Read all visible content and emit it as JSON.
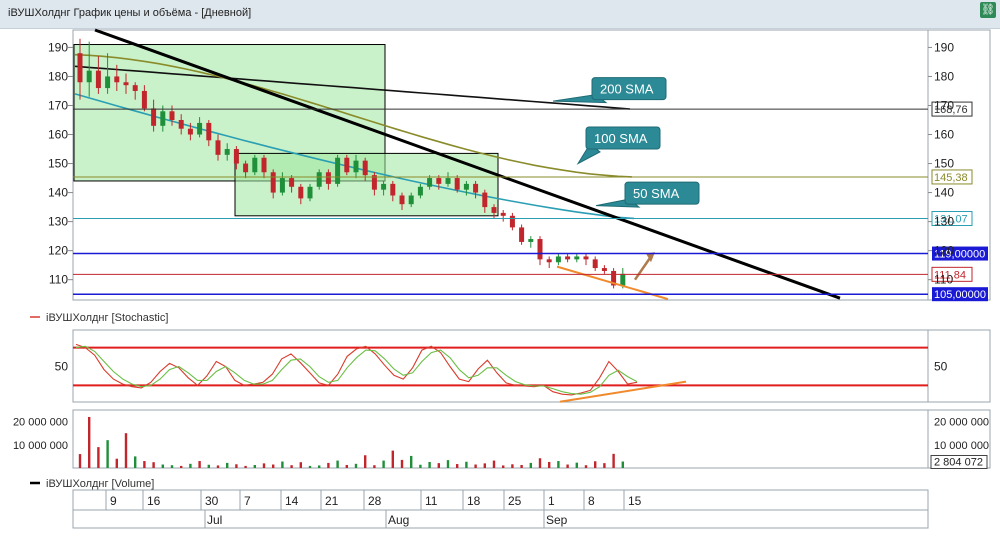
{
  "window": {
    "title": "iВУШХолднг График цены и объёма - [Дневной]",
    "link_icon": "link-icon"
  },
  "colors": {
    "up": "#1f8f3a",
    "down": "#c0262c",
    "sma200": "#111111",
    "sma100": "#8a8b2a",
    "sma50": "#2a9fb3",
    "trend": "#000000",
    "support": "#1a1ad6",
    "highlight": "#9ee89e",
    "stoch_k": "#d93b2c",
    "stoch_d": "#6abf45",
    "orange": "#f08a2c",
    "label_box": "#2b8a96"
  },
  "chart_data": [
    {
      "type": "line",
      "panel": "price",
      "ylim": [
        103,
        196
      ],
      "y_ticks": [
        "190",
        "180",
        "170",
        "160",
        "150",
        "140",
        "130",
        "120",
        "110"
      ],
      "y_right_ticks": [
        "190",
        "180",
        "170",
        "160",
        "150",
        "140",
        "130",
        "120",
        "110"
      ],
      "x_tick_labels": [
        "9",
        "16",
        "30",
        "7",
        "14",
        "21",
        "28",
        "11",
        "18",
        "25",
        "1",
        "8",
        "15"
      ],
      "month_labels": [
        "Jul",
        "Aug",
        "Sep"
      ],
      "candles": [
        [
          188,
          178,
          193,
          172
        ],
        [
          178,
          182,
          192,
          173
        ],
        [
          182,
          176,
          187,
          174
        ],
        [
          176,
          180,
          188,
          174
        ],
        [
          180,
          178,
          184,
          175
        ],
        [
          178,
          177,
          181,
          174
        ],
        [
          177,
          175,
          178,
          172
        ],
        [
          175,
          169,
          177,
          168
        ],
        [
          169,
          163,
          172,
          161
        ],
        [
          163,
          168,
          170,
          161
        ],
        [
          168,
          165,
          170,
          163
        ],
        [
          165,
          162,
          167,
          160
        ],
        [
          162,
          160,
          164,
          158
        ],
        [
          160,
          164,
          166,
          159
        ],
        [
          164,
          158,
          165,
          156
        ],
        [
          158,
          153,
          160,
          151
        ],
        [
          153,
          155,
          157,
          151
        ],
        [
          155,
          150,
          156,
          148
        ],
        [
          150,
          147,
          151,
          145
        ],
        [
          147,
          152,
          153,
          146
        ],
        [
          152,
          147,
          153,
          145
        ],
        [
          147,
          140,
          148,
          138
        ],
        [
          140,
          145,
          147,
          139
        ],
        [
          145,
          142,
          146,
          140
        ],
        [
          142,
          138,
          143,
          136
        ],
        [
          138,
          142,
          143,
          137
        ],
        [
          142,
          147,
          148,
          141
        ],
        [
          147,
          143,
          148,
          141
        ],
        [
          143,
          152,
          153,
          142
        ],
        [
          152,
          147,
          153,
          146
        ],
        [
          147,
          151,
          153,
          145
        ],
        [
          151,
          146,
          152,
          144
        ],
        [
          146,
          141,
          147,
          139
        ],
        [
          141,
          143,
          144,
          139
        ],
        [
          143,
          139,
          144,
          137
        ],
        [
          139,
          136,
          140,
          134
        ],
        [
          136,
          139,
          140,
          135
        ],
        [
          139,
          142,
          143,
          138
        ],
        [
          142,
          145,
          146,
          141
        ],
        [
          145,
          143,
          146,
          141
        ],
        [
          143,
          145,
          147,
          142
        ],
        [
          145,
          141,
          146,
          140
        ],
        [
          141,
          143,
          144,
          139
        ],
        [
          143,
          140,
          144,
          138
        ],
        [
          140,
          135,
          141,
          133
        ],
        [
          135,
          133,
          136,
          131
        ],
        [
          133,
          132,
          134,
          130
        ],
        [
          132,
          128,
          133,
          127
        ],
        [
          128,
          123,
          129,
          122
        ],
        [
          123,
          124,
          125,
          121
        ],
        [
          124,
          117,
          125,
          115
        ],
        [
          117,
          116,
          118,
          114
        ],
        [
          116,
          118,
          119,
          115
        ],
        [
          118,
          117,
          119,
          116
        ],
        [
          117,
          118,
          119,
          116
        ],
        [
          118,
          117,
          119,
          115
        ],
        [
          117,
          114,
          118,
          113
        ],
        [
          114,
          113,
          115,
          112
        ],
        [
          113,
          108,
          114,
          107
        ],
        [
          108,
          112,
          114,
          107
        ]
      ],
      "series": [
        {
          "name": "200 SMA",
          "y_start": 183.5,
          "y_end": 168.8
        },
        {
          "name": "100 SMA",
          "y_start": 187.5,
          "y_end": 145.4
        },
        {
          "name": "50 SMA",
          "y_start": 174.0,
          "y_end": 131.1
        }
      ],
      "trendline": {
        "y_start": 196.0,
        "y_end": 105.0
      },
      "levels": [
        {
          "value": "168,76",
          "y": 168.76,
          "color": "#333333"
        },
        {
          "value": "145,38",
          "y": 145.38,
          "color": "#8a8b2a"
        },
        {
          "value": "131,07",
          "y": 131.07,
          "color": "#2a9fb3"
        },
        {
          "value": "119,00000",
          "y": 119.0,
          "color": "#1a1ad6",
          "filled": true
        },
        {
          "value": "111,84",
          "y": 111.84,
          "color": "#c0262c"
        },
        {
          "value": "105,00000",
          "y": 105.0,
          "color": "#1a1ad6",
          "filled": true
        }
      ],
      "annotations": [
        "200 SMA",
        "100 SMA",
        "50 SMA"
      ]
    },
    {
      "type": "line",
      "panel": "stochastic",
      "title": "iВУШХолднг [Stochastic]",
      "ylim": [
        0,
        100
      ],
      "y_ticks": [
        "50"
      ],
      "y_right_ticks": [
        "50"
      ],
      "levels": [
        80,
        20
      ],
      "series": [
        {
          "name": "%K",
          "values": [
            85,
            80,
            68,
            45,
            30,
            22,
            18,
            16,
            25,
            42,
            55,
            48,
            32,
            20,
            35,
            58,
            50,
            28,
            20,
            22,
            25,
            38,
            62,
            70,
            56,
            40,
            24,
            20,
            38,
            66,
            78,
            82,
            70,
            52,
            36,
            30,
            48,
            76,
            82,
            72,
            50,
            30,
            26,
            46,
            60,
            40,
            24,
            20,
            19,
            18,
            20,
            10,
            6,
            5,
            8,
            12,
            32,
            58,
            42,
            22,
            25
          ]
        },
        {
          "name": "%D",
          "values": [
            80,
            82,
            74,
            58,
            42,
            30,
            22,
            18,
            20,
            30,
            45,
            50,
            40,
            28,
            28,
            42,
            50,
            40,
            28,
            22,
            22,
            28,
            45,
            60,
            62,
            50,
            34,
            25,
            28,
            48,
            64,
            76,
            75,
            62,
            46,
            36,
            40,
            58,
            72,
            76,
            64,
            45,
            32,
            36,
            48,
            48,
            36,
            26,
            21,
            19,
            19,
            15,
            10,
            7,
            6,
            9,
            18,
            36,
            44,
            34,
            26
          ]
        }
      ]
    },
    {
      "type": "bar",
      "panel": "volume",
      "title": "iВУШХолднг [Volume]",
      "ylim": [
        0,
        25000000
      ],
      "y_ticks": [
        "20 000 000",
        "10 000 000"
      ],
      "y_right_ticks": [
        "20 000 000",
        "10 000 000",
        "2 804 072"
      ],
      "values": [
        6000000,
        22000000,
        9000000,
        12000000,
        4000000,
        15000000,
        5000000,
        3000000,
        2500000,
        1500000,
        1200000,
        900000,
        1800000,
        3000000,
        1400000,
        1100000,
        2200000,
        1600000,
        900000,
        1300000,
        2000000,
        1500000,
        2800000,
        1200000,
        2500000,
        900000,
        1100000,
        2200000,
        3200000,
        1300000,
        1800000,
        5500000,
        1200000,
        3200000,
        7500000,
        3500000,
        5200000,
        1400000,
        2600000,
        2100000,
        3400000,
        1700000,
        2700000,
        1500000,
        2000000,
        3200000,
        1100000,
        1600000,
        1300000,
        2200000,
        4200000,
        2600000,
        3000000,
        1500000,
        2300000,
        1200000,
        2900000,
        2100000,
        6100000,
        2800000
      ],
      "colors_up_down": [
        "d",
        "d",
        "d",
        "u",
        "d",
        "d",
        "u",
        "d",
        "d",
        "u",
        "u",
        "d",
        "u",
        "d",
        "u",
        "d",
        "u",
        "d",
        "d",
        "u",
        "d",
        "d",
        "u",
        "d",
        "d",
        "u",
        "u",
        "d",
        "u",
        "d",
        "u",
        "d",
        "d",
        "u",
        "d",
        "d",
        "u",
        "u",
        "u",
        "d",
        "u",
        "d",
        "u",
        "d",
        "d",
        "d",
        "d",
        "d",
        "d",
        "u",
        "d",
        "d",
        "u",
        "d",
        "u",
        "d",
        "d",
        "d",
        "d",
        "u"
      ]
    }
  ]
}
